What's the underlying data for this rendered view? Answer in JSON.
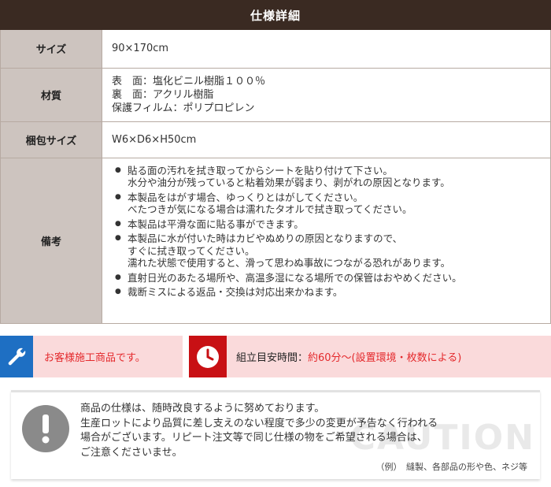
{
  "header": {
    "title": "仕様詳細"
  },
  "spec": {
    "size": {
      "label": "サイズ",
      "value": "90×170cm"
    },
    "material": {
      "label": "材質",
      "lines": [
        "表　面：塩化ビニル樹脂１００％",
        "裏　面：アクリル樹脂",
        "保護フィルム：ポリプロピレン"
      ]
    },
    "package": {
      "label": "梱包サイズ",
      "value": "W6×D6×H50cm"
    },
    "notes": {
      "label": "備考",
      "items": [
        {
          "lines": [
            "貼る面の汚れを拭き取ってからシートを貼り付けて下さい。",
            "水分や油分が残っていると粘着効果が弱まり、剥がれの原因となります。"
          ]
        },
        {
          "lines": [
            "本製品をはがす場合、ゆっくりとはがしてください。",
            "べたつきが気になる場合は濡れたタオルで拭き取ってください。"
          ]
        },
        {
          "lines": [
            "本製品は平滑な面に貼る事ができます。"
          ]
        },
        {
          "lines": [
            "本製品に水が付いた時はカビやぬめりの原因となりますので、",
            "すぐに拭き取ってください。",
            "濡れた状態で使用すると、滑って思わぬ事故につながる恐れがあります。"
          ]
        },
        {
          "lines": [
            "直射日光のあたる場所や、高温多湿になる場所での保管はおやめください。"
          ]
        },
        {
          "lines": [
            "裁断ミスによる返品・交換は対応出来かねます。"
          ]
        }
      ]
    }
  },
  "badges": {
    "customer_install": {
      "icon": "wrench-icon",
      "text": "お客様施工商品です。",
      "icon_bg": "#1e6fc3"
    },
    "assembly_time": {
      "icon": "clock-icon",
      "label": "組立目安時間：",
      "value": "約60分〜(設置環境・枚数による)",
      "icon_bg": "#c81014"
    }
  },
  "caution": {
    "icon": "exclamation-icon",
    "watermark": "CAUTION",
    "lines": [
      "商品の仕様は、随時改良するように努めております。",
      "生産ロットにより品質に差し支えのない程度で多少の変更が予告なく行われる",
      "場合がございます。リピート注文等で同じ仕様の物をご希望される場合は、",
      "ご注意くださいませ。"
    ],
    "example": "（例）　縫製、各部品の形や色、ネジ等"
  },
  "colors": {
    "header_bg": "#3a2a22",
    "label_bg": "#cdc4bf",
    "badge_bg": "#fadadb",
    "accent_red": "#e4292c"
  }
}
